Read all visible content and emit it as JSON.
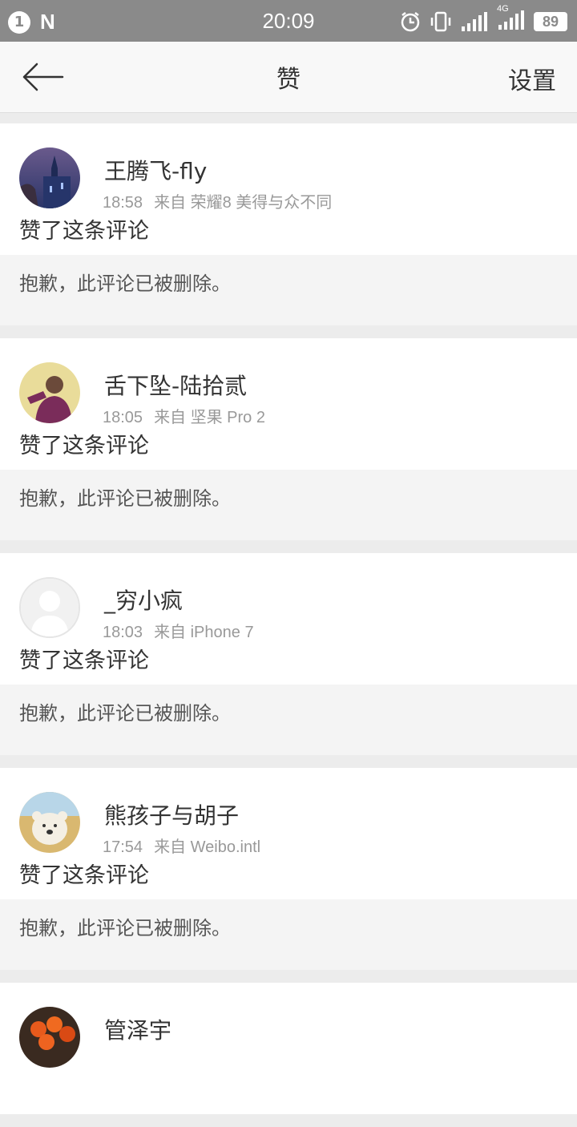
{
  "status_bar": {
    "notification_count": "1",
    "app_letter": "N",
    "time": "20:09",
    "network": "4G",
    "battery": "89"
  },
  "header": {
    "title": "赞",
    "settings_label": "设置"
  },
  "items": [
    {
      "name": "王腾飞-fly",
      "time": "18:58",
      "source": "来自 荣耀8 美得与众不同",
      "action": "赞了这条评论",
      "quote": "抱歉，此评论已被删除。"
    },
    {
      "name": "舌下坠-陆拾贰",
      "time": "18:05",
      "source": "来自 坚果 Pro 2",
      "action": "赞了这条评论",
      "quote": "抱歉，此评论已被删除。"
    },
    {
      "name": "_穷小疯",
      "time": "18:03",
      "source": "来自 iPhone 7",
      "action": "赞了这条评论",
      "quote": "抱歉，此评论已被删除。"
    },
    {
      "name": "熊孩子与胡子",
      "time": "17:54",
      "source": "来自 Weibo.intl",
      "action": "赞了这条评论",
      "quote": "抱歉，此评论已被删除。"
    },
    {
      "name": "管泽宇",
      "time": "",
      "source": "",
      "action": "",
      "quote": ""
    }
  ]
}
